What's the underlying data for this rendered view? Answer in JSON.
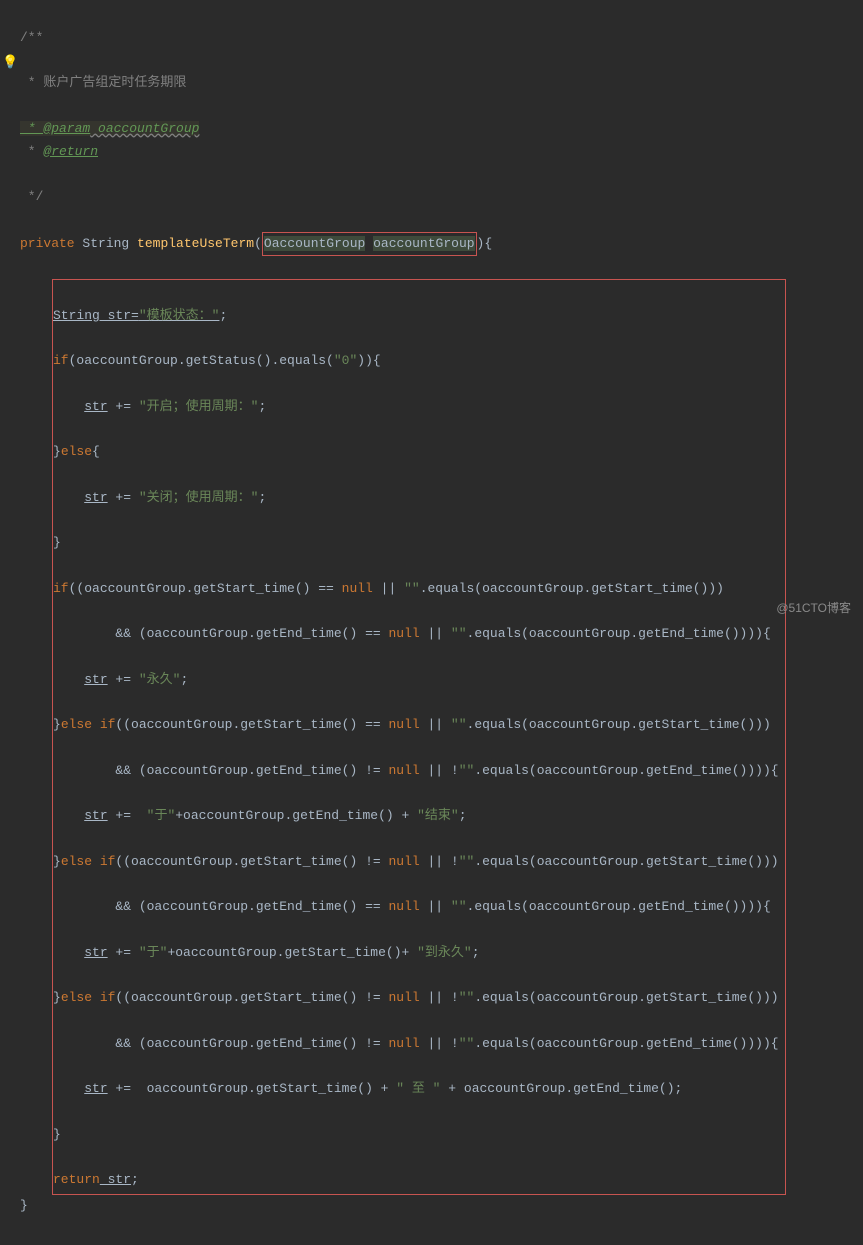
{
  "comment": {
    "open": "/**",
    "desc": " * 账户广告组定时任务期限",
    "param": " * @param",
    "paramName": " oaccountGroup",
    "ret": " * @return",
    "close": " */"
  },
  "sig": {
    "private": "private",
    "type": "String",
    "fn": "templateUseTerm",
    "paramType": "OaccountGroup",
    "paramName": "oaccountGroup"
  },
  "body": {
    "l1a": "String str=",
    "l1b": "\"模板状态：\"",
    "l1c": ";",
    "l2a": "if",
    "l2b": "(oaccountGroup.getStatus().equals(",
    "l2c": "\"0\"",
    "l2d": ")){",
    "l3a": "str",
    "l3b": " += ",
    "l3c": "\"开启；使用周期：\"",
    "l3d": ";",
    "l4": "}",
    "l4else": "else",
    "l4b": "{",
    "l5a": "str",
    "l5b": " += ",
    "l5c": "\"关闭；使用周期：\"",
    "l5d": ";",
    "l6": "}",
    "l7a": "if",
    "l7b": "((oaccountGroup.getStart_time() == ",
    "null": "null",
    "l7c": " || ",
    "l7d": "\"\"",
    "l7e": ".equals(oaccountGroup.getStart_time()))",
    "l8a": "&& (oaccountGroup.getEnd_time() == ",
    "l8b": " || ",
    "l8c": ".equals(oaccountGroup.getEnd_time()))){",
    "l9a": "str",
    "l9b": " += ",
    "l9c": "\"永久\"",
    "l9d": ";",
    "l10a": "}",
    "l10b": "else if",
    "l10c": "((oaccountGroup.getStart_time() == ",
    "l10d": " || ",
    "l10e": ".equals(oaccountGroup.getStart_time()))",
    "l11a": "&& (oaccountGroup.getEnd_time() != ",
    "l11b": " || !",
    "l11c": ".equals(oaccountGroup.getEnd_time()))){",
    "l12a": "str",
    "l12b": " +=  ",
    "l12c": "\"于\"",
    "l12d": "+oaccountGroup.getEnd_time() + ",
    "l12e": "\"结束\"",
    "l12f": ";",
    "l13a": "}",
    "l13b": "else if",
    "l13c": "((oaccountGroup.getStart_time() != ",
    "l13d": " || !",
    "l13e": ".equals(oaccountGroup.getStart_time()))",
    "l14a": "&& (oaccountGroup.getEnd_time() == ",
    "l14b": " || ",
    "l14c": ".equals(oaccountGroup.getEnd_time()))){",
    "l15a": "str",
    "l15b": " += ",
    "l15c": "\"于\"",
    "l15d": "+oaccountGroup.getStart_time()+ ",
    "l15e": "\"到永久\"",
    "l15f": ";",
    "l16a": "}",
    "l16b": "else if",
    "l16c": "((oaccountGroup.getStart_time() != ",
    "l16d": " || !",
    "l16e": ".equals(oaccountGroup.getStart_time()))",
    "l17a": "&& (oaccountGroup.getEnd_time() != ",
    "l17b": " || !",
    "l17c": ".equals(oaccountGroup.getEnd_time()))){",
    "l18a": "str",
    "l18b": " +=  oaccountGroup.getStart_time() + ",
    "l18c": "\" 至 \"",
    "l18d": " + oaccountGroup.getEnd_time();",
    "l19": "}",
    "l20a": "return",
    "l20b": " str",
    "l20c": ";"
  },
  "close": "}",
  "watermark": "@51CTO博客"
}
